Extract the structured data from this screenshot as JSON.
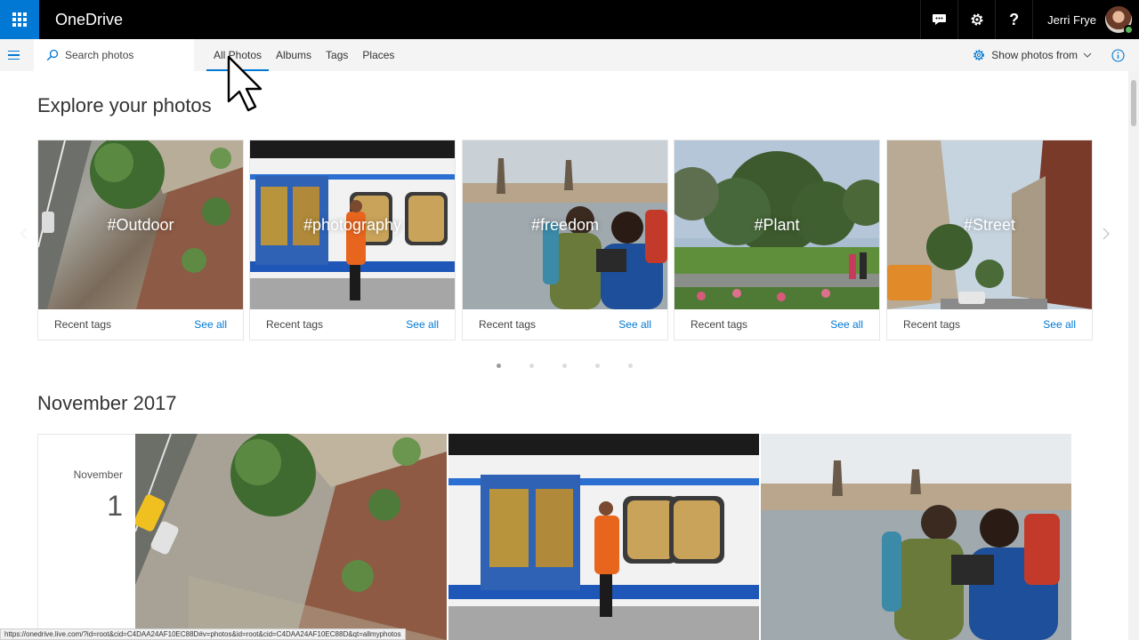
{
  "app": {
    "title": "OneDrive"
  },
  "user": {
    "name": "Jerri Frye"
  },
  "search": {
    "placeholder": "Search photos"
  },
  "tabs": [
    {
      "label": "All Photos",
      "active": true
    },
    {
      "label": "Albums"
    },
    {
      "label": "Tags"
    },
    {
      "label": "Places"
    }
  ],
  "toolbar": {
    "show_photos_from": "Show photos from"
  },
  "explore": {
    "title": "Explore your photos",
    "cards": [
      {
        "tag": "#Outdoor",
        "footer": "Recent tags",
        "link": "See all"
      },
      {
        "tag": "#photography",
        "footer": "Recent tags",
        "link": "See all"
      },
      {
        "tag": "#freedom",
        "footer": "Recent tags",
        "link": "See all"
      },
      {
        "tag": "#Plant",
        "footer": "Recent tags",
        "link": "See all"
      },
      {
        "tag": "#Street",
        "footer": "Recent tags",
        "link": "See all"
      }
    ],
    "carousel": {
      "pages": 5,
      "current": 1
    }
  },
  "timeline": {
    "title": "November 2017",
    "date": {
      "month": "November",
      "day": "1"
    }
  },
  "status_bar": {
    "url": "https://onedrive.live.com/?id=root&cid=C4DAA24AF10EC88D#v=photos&id=root&cid=C4DAA24AF10EC88D&qt=allmyphotos"
  },
  "colors": {
    "accent": "#0078d4",
    "topbar": "#000000",
    "subbar": "#f4f4f4"
  },
  "icons": [
    "app-launcher-icon",
    "feedback-icon",
    "settings-icon",
    "help-icon",
    "search-icon",
    "hamburger-icon",
    "gear-icon",
    "chevron-down-icon",
    "info-icon",
    "chevron-right-icon",
    "chevron-left-icon",
    "mouse-cursor-icon"
  ]
}
